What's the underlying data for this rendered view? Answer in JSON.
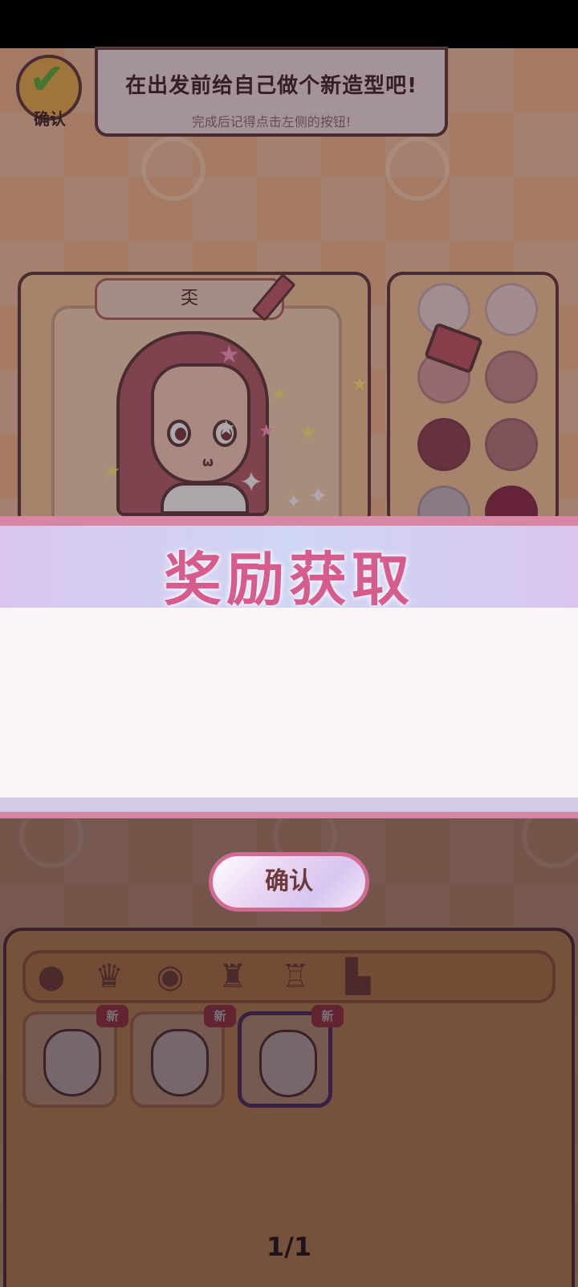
{
  "header": {
    "confirm_label": "确认",
    "tip_title": "在出发前给自己做个新造型吧!",
    "tip_subtitle": "完成后记得点击左侧的按钮!"
  },
  "character": {
    "name": "奀"
  },
  "palette": {
    "swatch_colors": [
      "#eed8d6",
      "#efd6d2",
      "#d9a1a0",
      "#c98f8f",
      "#8e4452",
      "#b67a7e",
      "#c6bcc2",
      "#8e2c4a"
    ]
  },
  "wardrobe": {
    "tabs": [
      "face-tab",
      "hair-tab",
      "eyes-tab",
      "top-tab",
      "outfit-tab",
      "shoes-tab"
    ],
    "items": [
      {
        "badge": "新",
        "selected": false
      },
      {
        "badge": "新",
        "selected": false
      },
      {
        "badge": "新",
        "selected": true
      }
    ],
    "page_indicator": "1/1"
  },
  "reward_modal": {
    "title": "奖励获取",
    "confirm_button": "确认"
  },
  "colors": {
    "accent_pink": "#d65c8e",
    "panel_orange": "#f5b46b",
    "outline": "#5c3b3b"
  }
}
